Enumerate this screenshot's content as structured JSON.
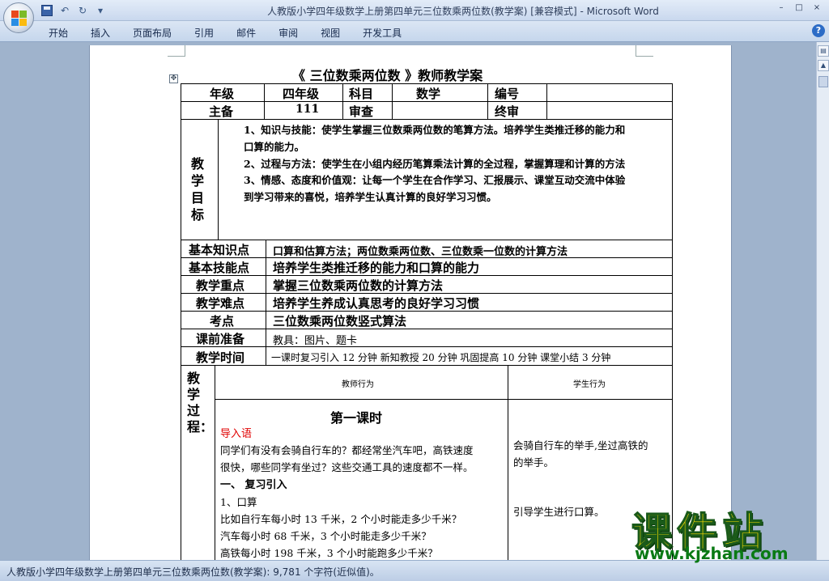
{
  "window": {
    "title": "人教版小学四年级数学上册第四单元三位数乘两位数(教学案) [兼容模式] - Microsoft Word",
    "controls": [
      "–",
      "□",
      "×"
    ]
  },
  "quick_access": {
    "undo": "↶",
    "redo": "↻",
    "more": "▾"
  },
  "ribbon": {
    "tabs": [
      "开始",
      "插入",
      "页面布局",
      "引用",
      "邮件",
      "审阅",
      "视图",
      "开发工具"
    ],
    "help": "?"
  },
  "document": {
    "title": "《 三位数乘两位数 》教师教学案",
    "header_row1": {
      "grade_label": "年级",
      "grade_value": "四年级",
      "subject_label": "科目",
      "subject_value": "数学",
      "number_label": "编号",
      "number_value": ""
    },
    "header_row2": {
      "lead_label": "主备",
      "lead_value": "111",
      "review_label": "审查",
      "review_value": "",
      "final_label": "终审",
      "final_value": ""
    },
    "objectives_label": [
      "教",
      "学",
      "目",
      "标"
    ],
    "objectives": [
      "1、知识与技能：使学生掌握三位数乘两位数的笔算方法。培养学生类推迁移的能力和",
      "口算的能力。",
      "2、过程与方法：使学生在小组内经历笔算乘法计算的全过程，掌握算理和计算的方法",
      "3、情感、态度和价值观：让每一个学生在合作学习、汇报展示、课堂互动交流中体验",
      "到学习带来的喜悦，培养学生认真计算的良好学习习惯。"
    ],
    "rows": [
      {
        "label": "基本知识点",
        "value": "口算和估算方法；两位数乘两位数、三位数乘一位数的计算方法"
      },
      {
        "label": "基本技能点",
        "value": "培养学生类推迁移的能力和口算的能力"
      },
      {
        "label": "教学重点",
        "value": "掌握三位数乘两位数的计算方法"
      },
      {
        "label": "教学难点",
        "value": "培养学生养成认真思考的良好学习习惯"
      },
      {
        "label": "考点",
        "value": "三位数乘两位数竖式算法"
      },
      {
        "label": "课前准备",
        "value": "教具：图片、题卡"
      },
      {
        "label": "教学时间",
        "value": "一课时复习引入 12 分钟   新知教授  20 分钟   巩固提高 10 分钟  课堂小结 3 分钟"
      }
    ],
    "process": {
      "label": [
        "教",
        "学",
        "过",
        "程："
      ],
      "teacher_header": "教师行为",
      "student_header": "学生行为",
      "lesson_title": "第一课时",
      "intro_heading": "导入语",
      "intro_text": [
        "同学们有没有会骑自行车的？都经常坐汽车吧，高铁速度",
        "很快，哪些同学有坐过？这些交通工具的速度都不一样。"
      ],
      "section1": "一、 复习引入",
      "item1": "1、口算",
      "questions": [
        "比如自行车每小时 13 千米，2 个小时能走多少千米？",
        "汽车每小时 68 千米，3 个小时能走多少千米？",
        "高铁每小时 198 千米，3 个小时能跑多少千米？"
      ],
      "student_texts": [
        "会骑自行车的举手,坐过高铁的",
        "的举手。",
        "引导学生进行口算。"
      ]
    }
  },
  "status_bar": {
    "text": "人教版小学四年级数学上册第四单元三位数乘两位数(教学案): 9,781 个字符(近似值)。"
  },
  "watermark": {
    "title": "课件站",
    "url": "www.kjzhan.com"
  },
  "colors": {
    "accent_red": "#e00000",
    "watermark_yellow": "#ffe000",
    "watermark_green": "#0a7a14"
  }
}
